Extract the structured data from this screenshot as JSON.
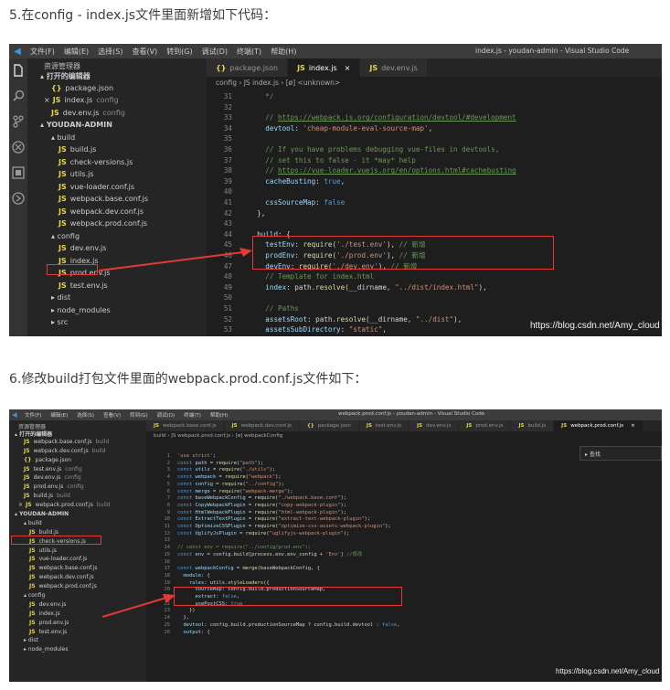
{
  "step5": "5.在config - index.js文件里面新增如下代码：",
  "step6": "6.修改build打包文件里面的webpack.prod.conf.js文件如下：",
  "shot1": {
    "menu": [
      "文件(F)",
      "编辑(E)",
      "选择(S)",
      "查看(V)",
      "转到(G)",
      "调试(D)",
      "终端(T)",
      "帮助(H)"
    ],
    "window_title": "index.js - youdan-admin - Visual Studio Code",
    "explorer_title": "资源管理器",
    "open_editors": "打开的编辑器",
    "open_files": [
      {
        "icon": "{}",
        "name": "package.json",
        "dir": "",
        "close": ""
      },
      {
        "icon": "JS",
        "name": "index.js",
        "dir": "config",
        "close": "×"
      },
      {
        "icon": "JS",
        "name": "dev.env.js",
        "dir": "config",
        "close": ""
      }
    ],
    "project": "YOUDAN-ADMIN",
    "tree": [
      {
        "t": "▴ build",
        "d": 1,
        "icon": ""
      },
      {
        "t": "build.js",
        "d": 2,
        "icon": "JS"
      },
      {
        "t": "check-versions.js",
        "d": 2,
        "icon": "JS"
      },
      {
        "t": "utils.js",
        "d": 2,
        "icon": "JS"
      },
      {
        "t": "vue-loader.conf.js",
        "d": 2,
        "icon": "JS"
      },
      {
        "t": "webpack.base.conf.js",
        "d": 2,
        "icon": "JS"
      },
      {
        "t": "webpack.dev.conf.js",
        "d": 2,
        "icon": "JS"
      },
      {
        "t": "webpack.prod.conf.js",
        "d": 2,
        "icon": "JS"
      },
      {
        "t": "▴ config",
        "d": 1,
        "icon": ""
      },
      {
        "t": "dev.env.js",
        "d": 2,
        "icon": "JS"
      },
      {
        "t": "index.js",
        "d": 2,
        "icon": "JS"
      },
      {
        "t": "prod.env.js",
        "d": 2,
        "icon": "JS"
      },
      {
        "t": "test.env.js",
        "d": 2,
        "icon": "JS"
      },
      {
        "t": "▸ dist",
        "d": 1,
        "icon": ""
      },
      {
        "t": "▸ node_modules",
        "d": 1,
        "icon": ""
      },
      {
        "t": "▸ src",
        "d": 1,
        "icon": ""
      }
    ],
    "tabs": [
      {
        "icon": "{}",
        "label": "package.json",
        "active": false,
        "close": ""
      },
      {
        "icon": "JS",
        "label": "index.js",
        "active": true,
        "close": "×"
      },
      {
        "icon": "JS",
        "label": "dev.env.js",
        "active": false,
        "close": ""
      }
    ],
    "breadcrumb": "config › JS index.js › [ø] <unknown>",
    "lines": [
      {
        "n": "31",
        "h": "    <span class=\"cm\">*/</span>"
      },
      {
        "n": "32",
        "h": ""
      },
      {
        "n": "33",
        "h": "    <span class=\"cm\">// <span class=\"url\">https://webpack.js.org/configuration/devtool/#development</span></span>"
      },
      {
        "n": "34",
        "h": "    <span class=\"pr\">devtool</span>: <span class=\"st\">'cheap-module-eval-source-map'</span>,"
      },
      {
        "n": "35",
        "h": ""
      },
      {
        "n": "36",
        "h": "    <span class=\"cm\">// If you have problems debugging vue-files in devtools,</span>"
      },
      {
        "n": "37",
        "h": "    <span class=\"cm\">// set this to false - it *may* help</span>"
      },
      {
        "n": "38",
        "h": "    <span class=\"cm\">// <span class=\"url\">https://vue-loader.vuejs.org/en/options.html#cachebusting</span></span>"
      },
      {
        "n": "39",
        "h": "    <span class=\"pr\">cacheBusting</span>: <span class=\"kw\">true</span>,"
      },
      {
        "n": "40",
        "h": ""
      },
      {
        "n": "41",
        "h": "    <span class=\"pr\">cssSourceMap</span>: <span class=\"kw\">false</span>"
      },
      {
        "n": "42",
        "h": "  },"
      },
      {
        "n": "43",
        "h": ""
      },
      {
        "n": "44",
        "h": "  <span class=\"pr\">build</span>: {"
      },
      {
        "n": "45",
        "h": "    <span class=\"pr\">testEnv</span>: <span class=\"fn\">require</span>(<span class=\"st\">'./test.env'</span>), <span class=\"cm\">// 新增</span>"
      },
      {
        "n": "46",
        "h": "    <span class=\"pr\">prodEnv</span>: <span class=\"fn\">require</span>(<span class=\"st\">'./prod.env'</span>), <span class=\"cm\">// 新增</span>"
      },
      {
        "n": "47",
        "h": "    <span class=\"pr\">devEnv</span>: <span class=\"fn\">require</span>(<span class=\"st\">'./dev.env'</span>), <span class=\"cm\">// 新增</span>"
      },
      {
        "n": "48",
        "h": "    <span class=\"cm\">// Template for index.html</span>"
      },
      {
        "n": "49",
        "h": "    <span class=\"pr\">index</span>: path.<span class=\"fn\">resolve</span>(__dirname, <span class=\"st\">\"../dist/index.html\"</span>),"
      },
      {
        "n": "50",
        "h": ""
      },
      {
        "n": "51",
        "h": "    <span class=\"cm\">// Paths</span>"
      },
      {
        "n": "52",
        "h": "    <span class=\"pr\">assetsRoot</span>: path.<span class=\"fn\">resolve</span>(__dirname, <span class=\"st\">\"../dist\"</span>),"
      },
      {
        "n": "53",
        "h": "    <span class=\"pr\">assetsSubDirectory</span>: <span class=\"st\">\"static\"</span>,"
      }
    ],
    "watermark": "https://blog.csdn.net/Amy_cloud"
  },
  "shot2": {
    "menu": [
      "文件(F)",
      "编辑(E)",
      "选择(S)",
      "查看(V)",
      "转到(G)",
      "调试(D)",
      "终端(T)",
      "帮助(H)"
    ],
    "window_title": "webpack.prod.conf.js - youdan-admin - Visual Studio Code",
    "explorer_title": "资源管理器",
    "open_editors": "打开的编辑器",
    "open_files": [
      {
        "icon": "JS",
        "name": "webpack.base.conf.js",
        "dir": "build",
        "close": ""
      },
      {
        "icon": "JS",
        "name": "webpack.dev.conf.js",
        "dir": "build",
        "close": ""
      },
      {
        "icon": "{}",
        "name": "package.json",
        "dir": "",
        "close": ""
      },
      {
        "icon": "JS",
        "name": "test.env.js",
        "dir": "config",
        "close": ""
      },
      {
        "icon": "JS",
        "name": "dev.env.js",
        "dir": "config",
        "close": ""
      },
      {
        "icon": "JS",
        "name": "prod.env.js",
        "dir": "config",
        "close": ""
      },
      {
        "icon": "JS",
        "name": "build.js",
        "dir": "build",
        "close": ""
      },
      {
        "icon": "JS",
        "name": "webpack.prod.conf.js",
        "dir": "build",
        "close": "×"
      }
    ],
    "project": "YOUDAN-ADMIN",
    "tree": [
      {
        "t": "▴ build",
        "d": 1,
        "icon": ""
      },
      {
        "t": "build.js",
        "d": 2,
        "icon": "JS"
      },
      {
        "t": "check-versions.js",
        "d": 2,
        "icon": "JS"
      },
      {
        "t": "utils.js",
        "d": 2,
        "icon": "JS"
      },
      {
        "t": "vue-loader.conf.js",
        "d": 2,
        "icon": "JS"
      },
      {
        "t": "webpack.base.conf.js",
        "d": 2,
        "icon": "JS"
      },
      {
        "t": "webpack.dev.conf.js",
        "d": 2,
        "icon": "JS"
      },
      {
        "t": "webpack.prod.conf.js",
        "d": 2,
        "icon": "JS"
      },
      {
        "t": "▴ config",
        "d": 1,
        "icon": ""
      },
      {
        "t": "dev.env.js",
        "d": 2,
        "icon": "JS"
      },
      {
        "t": "index.js",
        "d": 2,
        "icon": "JS"
      },
      {
        "t": "prod.env.js",
        "d": 2,
        "icon": "JS"
      },
      {
        "t": "test.env.js",
        "d": 2,
        "icon": "JS"
      },
      {
        "t": "▸ dist",
        "d": 1,
        "icon": ""
      },
      {
        "t": "▸ node_modules",
        "d": 1,
        "icon": ""
      }
    ],
    "tabs": [
      {
        "icon": "JS",
        "label": "webpack.base.conf.js",
        "active": false,
        "close": ""
      },
      {
        "icon": "JS",
        "label": "webpack.dev.conf.js",
        "active": false,
        "close": ""
      },
      {
        "icon": "{}",
        "label": "package.json",
        "active": false,
        "close": ""
      },
      {
        "icon": "JS",
        "label": "test.env.js",
        "active": false,
        "close": ""
      },
      {
        "icon": "JS",
        "label": "dev.env.js",
        "active": false,
        "close": ""
      },
      {
        "icon": "JS",
        "label": "prod.env.js",
        "active": false,
        "close": ""
      },
      {
        "icon": "JS",
        "label": "build.js",
        "active": false,
        "close": ""
      },
      {
        "icon": "JS",
        "label": "webpack.prod.conf.js",
        "active": true,
        "close": "×"
      }
    ],
    "breadcrumb": "build › JS webpack.prod.conf.js › [ø] webpackConfig",
    "find_label": "▸ 查找",
    "lines": [
      {
        "n": "1",
        "h": "<span class=\"st\">'use strict'</span>;"
      },
      {
        "n": "2",
        "h": "<span class=\"kw\">const</span> <span class=\"pr\">path</span> = <span class=\"fn\">require</span>(<span class=\"st\">\"path\"</span>);"
      },
      {
        "n": "3",
        "h": "<span class=\"kw\">const</span> <span class=\"pr\">utils</span> = <span class=\"fn\">require</span>(<span class=\"st\">\"./utils\"</span>);"
      },
      {
        "n": "4",
        "h": "<span class=\"kw\">const</span> <span class=\"pr\">webpack</span> = <span class=\"fn\">require</span>(<span class=\"st\">\"webpack\"</span>);"
      },
      {
        "n": "5",
        "h": "<span class=\"kw\">const</span> <span class=\"pr\">config</span> = <span class=\"fn\">require</span>(<span class=\"st\">\"../config\"</span>);"
      },
      {
        "n": "6",
        "h": "<span class=\"kw\">const</span> <span class=\"pr\">merge</span> = <span class=\"fn\">require</span>(<span class=\"st\">\"webpack-merge\"</span>);"
      },
      {
        "n": "7",
        "h": "<span class=\"kw\">const</span> <span class=\"pr\">baseWebpackConfig</span> = <span class=\"fn\">require</span>(<span class=\"st\">\"./webpack.base.conf\"</span>);"
      },
      {
        "n": "8",
        "h": "<span class=\"kw\">const</span> <span class=\"pr\">CopyWebpackPlugin</span> = <span class=\"fn\">require</span>(<span class=\"st\">\"copy-webpack-plugin\"</span>);"
      },
      {
        "n": "9",
        "h": "<span class=\"kw\">const</span> <span class=\"pr\">HtmlWebpackPlugin</span> = <span class=\"fn\">require</span>(<span class=\"st\">\"html-webpack-plugin\"</span>);"
      },
      {
        "n": "10",
        "h": "<span class=\"kw\">const</span> <span class=\"pr\">ExtractTextPlugin</span> = <span class=\"fn\">require</span>(<span class=\"st\">\"extract-text-webpack-plugin\"</span>);"
      },
      {
        "n": "11",
        "h": "<span class=\"kw\">const</span> <span class=\"pr\">OptimizeCSSPlugin</span> = <span class=\"fn\">require</span>(<span class=\"st\">\"optimize-css-assets-webpack-plugin\"</span>);"
      },
      {
        "n": "12",
        "h": "<span class=\"kw\">const</span> <span class=\"pr\">UglifyJsPlugin</span> = <span class=\"fn\">require</span>(<span class=\"st\">\"uglifyjs-webpack-plugin\"</span>);"
      },
      {
        "n": "13",
        "h": ""
      },
      {
        "n": "14",
        "h": "<span class=\"cm\">// const env = require(\"../config/prod.env\");</span>"
      },
      {
        "n": "15",
        "h": "<span class=\"kw\">const</span> <span class=\"pr\">env</span> = config.build[process.env.env_config + <span class=\"st\">'Env'</span>] <span class=\"cm\">//修改</span>"
      },
      {
        "n": "16",
        "h": ""
      },
      {
        "n": "17",
        "h": "<span class=\"kw\">const</span> <span class=\"pr\">webpackConfig</span> = <span class=\"fn\">merge</span>(baseWebpackConfig, {"
      },
      {
        "n": "18",
        "h": "  <span class=\"pr\">module</span>: {"
      },
      {
        "n": "19",
        "h": "    <span class=\"pr\">rules</span>: utils.<span class=\"fn\">styleLoaders</span>({"
      },
      {
        "n": "20",
        "h": "      <span class=\"pr\">sourceMap</span>: config.build.productionSourceMap,"
      },
      {
        "n": "21",
        "h": "      <span class=\"pr\">extract</span>: <span class=\"kw\">false</span>,"
      },
      {
        "n": "22",
        "h": "      <span class=\"pr\">usePostCSS</span>: <span class=\"kw\">true</span>"
      },
      {
        "n": "23",
        "h": "    })"
      },
      {
        "n": "24",
        "h": "  },"
      },
      {
        "n": "25",
        "h": "  <span class=\"pr\">devtool</span>: config.build.productionSourceMap ? config.build.devtool : <span class=\"kw\">false</span>,"
      },
      {
        "n": "26",
        "h": "  <span class=\"pr\">output</span>: {"
      }
    ],
    "watermark": "https://blog.csdn.net/Amy_cloud"
  }
}
